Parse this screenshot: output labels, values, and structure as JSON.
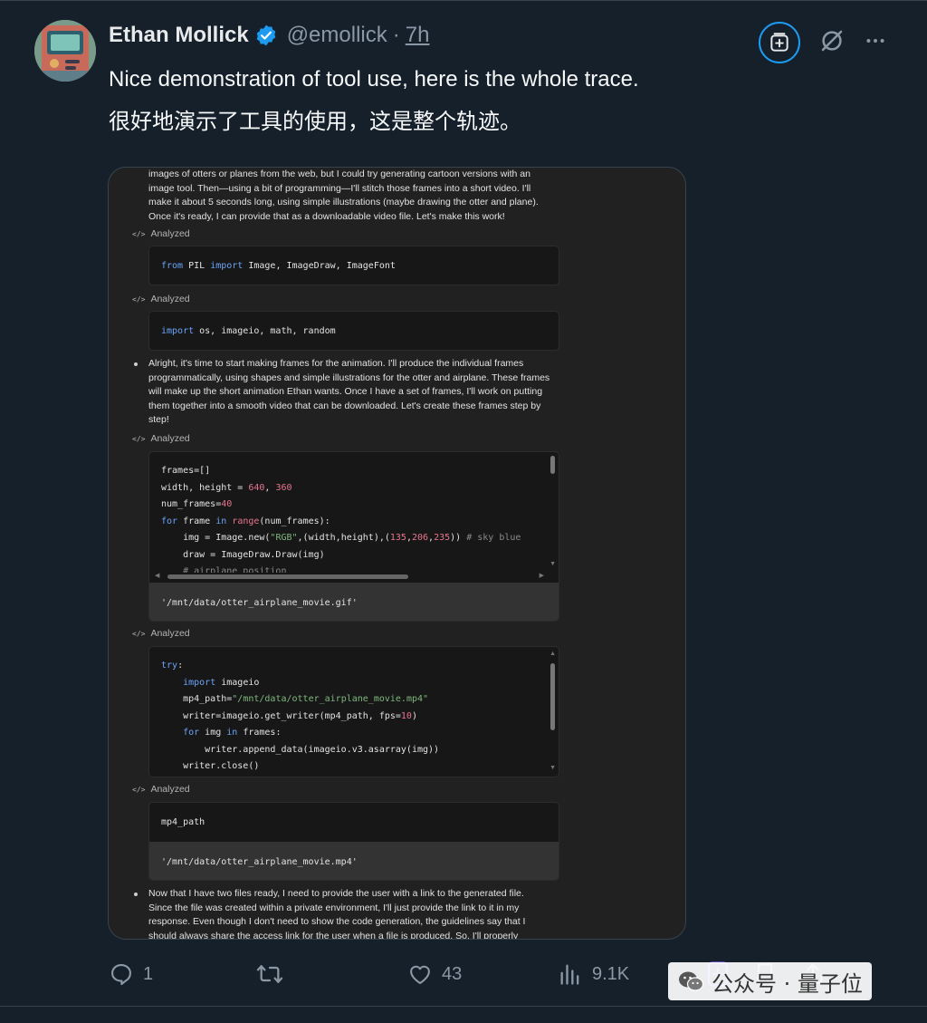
{
  "tweet": {
    "author_name": "Ethan Mollick",
    "handle": "@emollick",
    "separator": "·",
    "time": "7h",
    "text_en": "Nice demonstration of tool use, here is the whole trace.",
    "text_zh": "很好地演示了工具的使用，这是整个轨迹。"
  },
  "colors": {
    "background": "#15202b",
    "accent": "#1d9bf0",
    "muted": "#8b98a5",
    "code_keyword": "#6ba4f8",
    "code_number": "#e8758f",
    "code_string": "#7fb77e"
  },
  "icons": {
    "verified": "verified-badge-icon",
    "grok": "grok-icon",
    "more": "more-icon",
    "reply": "reply-icon",
    "retweet": "retweet-icon",
    "like": "like-icon",
    "views": "views-icon",
    "bookmark": "bookmark-icon",
    "share": "share-icon",
    "add": "add-icon"
  },
  "trace": {
    "para1": [
      "images of otters or planes from the web, but I could try generating cartoon versions with an",
      "image tool. Then—using a bit of programming—I'll stitch those frames into a short video. I'll",
      "make it about 5 seconds long, using simple illustrations (maybe drawing the otter and plane).",
      "Once it's ready, I can provide that as a downloadable video file. Let's make this work!"
    ],
    "analyzed_label": "Analyzed",
    "code1": {
      "kw1": "from",
      "mod": " PIL ",
      "kw2": "import",
      "rest": " Image, ImageDraw, ImageFont"
    },
    "code2": {
      "kw1": "import",
      "rest": " os, imageio, math, random"
    },
    "para2": [
      "Alright, it's time to start making frames for the animation. I'll produce the individual frames",
      "programmatically, using shapes and simple illustrations for the otter and airplane. These frames",
      "will make up the short animation Ethan wants. Once I have a set of frames, I'll work on putting",
      "them together into a smooth video that can be downloaded. Let's create these frames step by",
      "step!"
    ],
    "code3": {
      "l1": "frames=[]",
      "l2a": "width, height = ",
      "l2n1": "640",
      "l2c": ", ",
      "l2n2": "360",
      "l3a": "num_frames=",
      "l3n": "40",
      "l4kw": "for",
      "l4a": " frame ",
      "l4in": "in",
      "l4sp": " ",
      "l4fn": "range",
      "l4b": "(num_frames):",
      "l5a": "    img = Image.new(",
      "l5s": "\"RGB\"",
      "l5b": ",(width,height),(",
      "l5n1": "135",
      "l5c1": ",",
      "l5n2": "206",
      "l5c2": ",",
      "l5n3": "235",
      "l5d": ")) ",
      "l5cm": "# sky blue",
      "l6": "    draw = ImageDraw.Draw(img)",
      "l7": "    # airplane position",
      "output": "'/mnt/data/otter_airplane_movie.gif'"
    },
    "code4": {
      "l1kw": "try",
      "l1b": ":",
      "l2a": "    ",
      "l2kw": "import",
      "l2b": " imageio",
      "l3a": "    mp4_path=",
      "l3s": "\"/mnt/data/otter_airplane_movie.mp4\"",
      "l4a": "    writer=imageio.get_writer(mp4_path, fps=",
      "l4n": "10",
      "l4b": ")",
      "l5a": "    ",
      "l5kw": "for",
      "l5b": " img ",
      "l5in": "in",
      "l5c": " frames:",
      "l6": "        writer.append_data(imageio.v3.asarray(img))",
      "l7": "    writer.close()"
    },
    "code5": {
      "l1": "mp4_path",
      "output": "'/mnt/data/otter_airplane_movie.mp4'"
    },
    "para3": [
      "Now that I have two files ready, I need to provide the user with a link to the generated file.",
      "Since the file was created within a private environment, I'll just provide the link to it in my",
      "response. Even though I don't need to show the code generation, the guidelines say that I",
      "should always share the access link for the user when a file is produced. So, I'll properly"
    ]
  },
  "actions": {
    "reply_count": "1",
    "like_count": "43",
    "views_count": "9.1K"
  },
  "watermark": {
    "text": "公众号 · 量子位"
  }
}
